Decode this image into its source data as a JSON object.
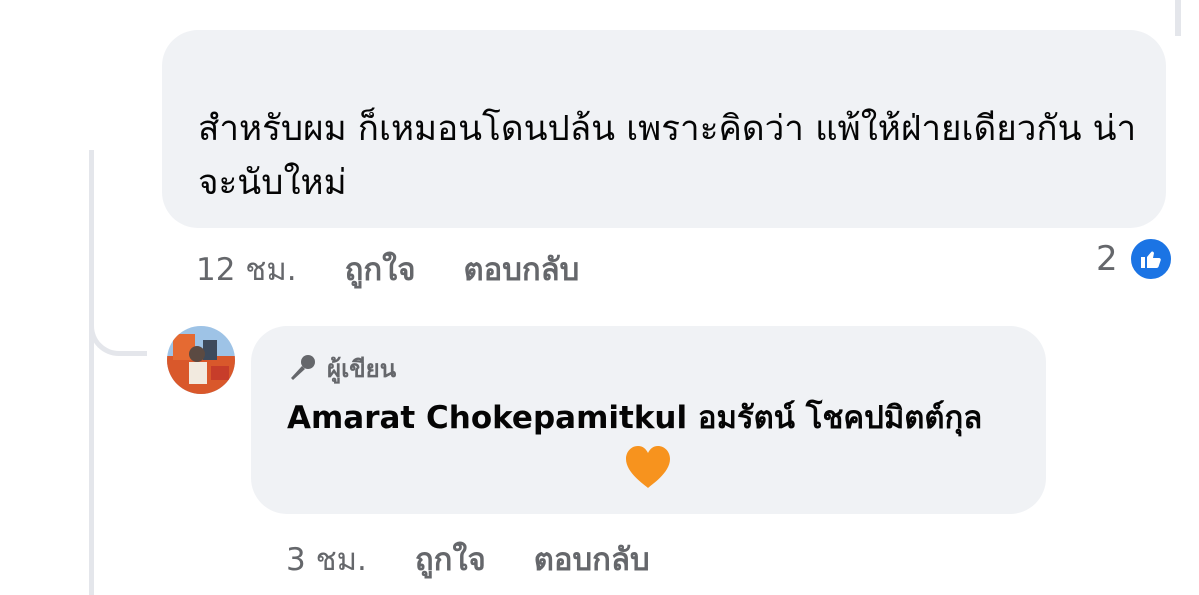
{
  "comment": {
    "text": "สำหรับผม ก็เหมอนโดนปล้น เพราะคิดว่า แพ้ให้ฝ่ายเดียวกัน น่าจะนับใหม่",
    "time": "12 ชม.",
    "like_label": "ถูกใจ",
    "reply_label": "ตอบกลับ",
    "reaction_count": "2",
    "reaction_icon": "thumbs-up-icon",
    "reaction_color": "#1b74e4"
  },
  "reply": {
    "badge_icon": "microphone-icon",
    "badge_label": "ผู้เขียน",
    "author": "Amarat Chokepamitkul อมรัตน์ โชคปมิตต์กุล",
    "emoji": "orange-heart-icon",
    "time": "3 ชม.",
    "like_label": "ถูกใจ",
    "reply_label": "ตอบกลับ"
  },
  "colors": {
    "bubble": "#f0f2f5",
    "meta_text": "#65676b",
    "heart": "#f7931e"
  }
}
